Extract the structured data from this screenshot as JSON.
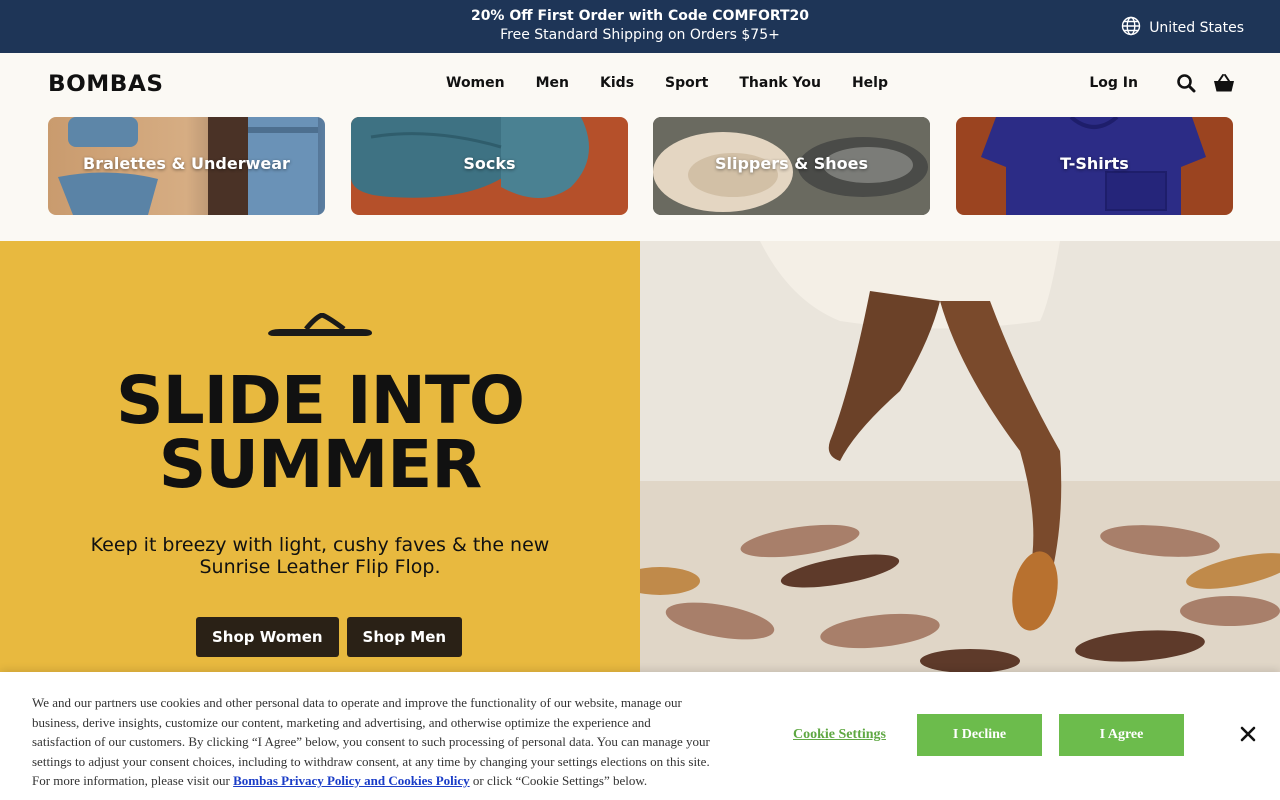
{
  "promo": {
    "line1": "20% Off First Order with Code COMFORT20",
    "line2": "Free Standard Shipping on Orders $75+",
    "region": "United States"
  },
  "header": {
    "logo": "BOMBAS",
    "nav": [
      "Women",
      "Men",
      "Kids",
      "Sport",
      "Thank You",
      "Help"
    ],
    "login": "Log In"
  },
  "categories": [
    {
      "label": "Bralettes & Underwear"
    },
    {
      "label": "Socks"
    },
    {
      "label": "Slippers & Shoes"
    },
    {
      "label": "T-Shirts"
    }
  ],
  "hero": {
    "headline_line1": "SLIDE INTO",
    "headline_line2": "SUMMER",
    "subcopy_line1": "Keep it breezy with light, cushy faves & the new",
    "subcopy_line2": "Sunrise Leather Flip Flop.",
    "cta_women": "Shop Women",
    "cta_men": "Shop Men",
    "bg_color": "#e8b93f"
  },
  "cookie": {
    "text": "We and our partners use cookies and other personal data to operate and improve the functionality of our website, manage our business, derive insights, customize our content, marketing and advertising, and otherwise optimize the experience and satisfaction of our customers. By clicking “I Agree” below, you consent to such processing of personal data. You can manage your settings to adjust your consent choices, including to withdraw consent, at any time by changing your settings elections on this site. For more information, please visit our ",
    "link": "Bombas Privacy Policy and Cookies Policy",
    "text_after": " or click “Cookie Settings” below.",
    "settings": "Cookie Settings",
    "decline": "I Decline",
    "agree": "I Agree",
    "accent": "#6cbc4c"
  },
  "colors": {
    "promo_bg": "#1e3557",
    "cta_bg": "#2a2116"
  }
}
